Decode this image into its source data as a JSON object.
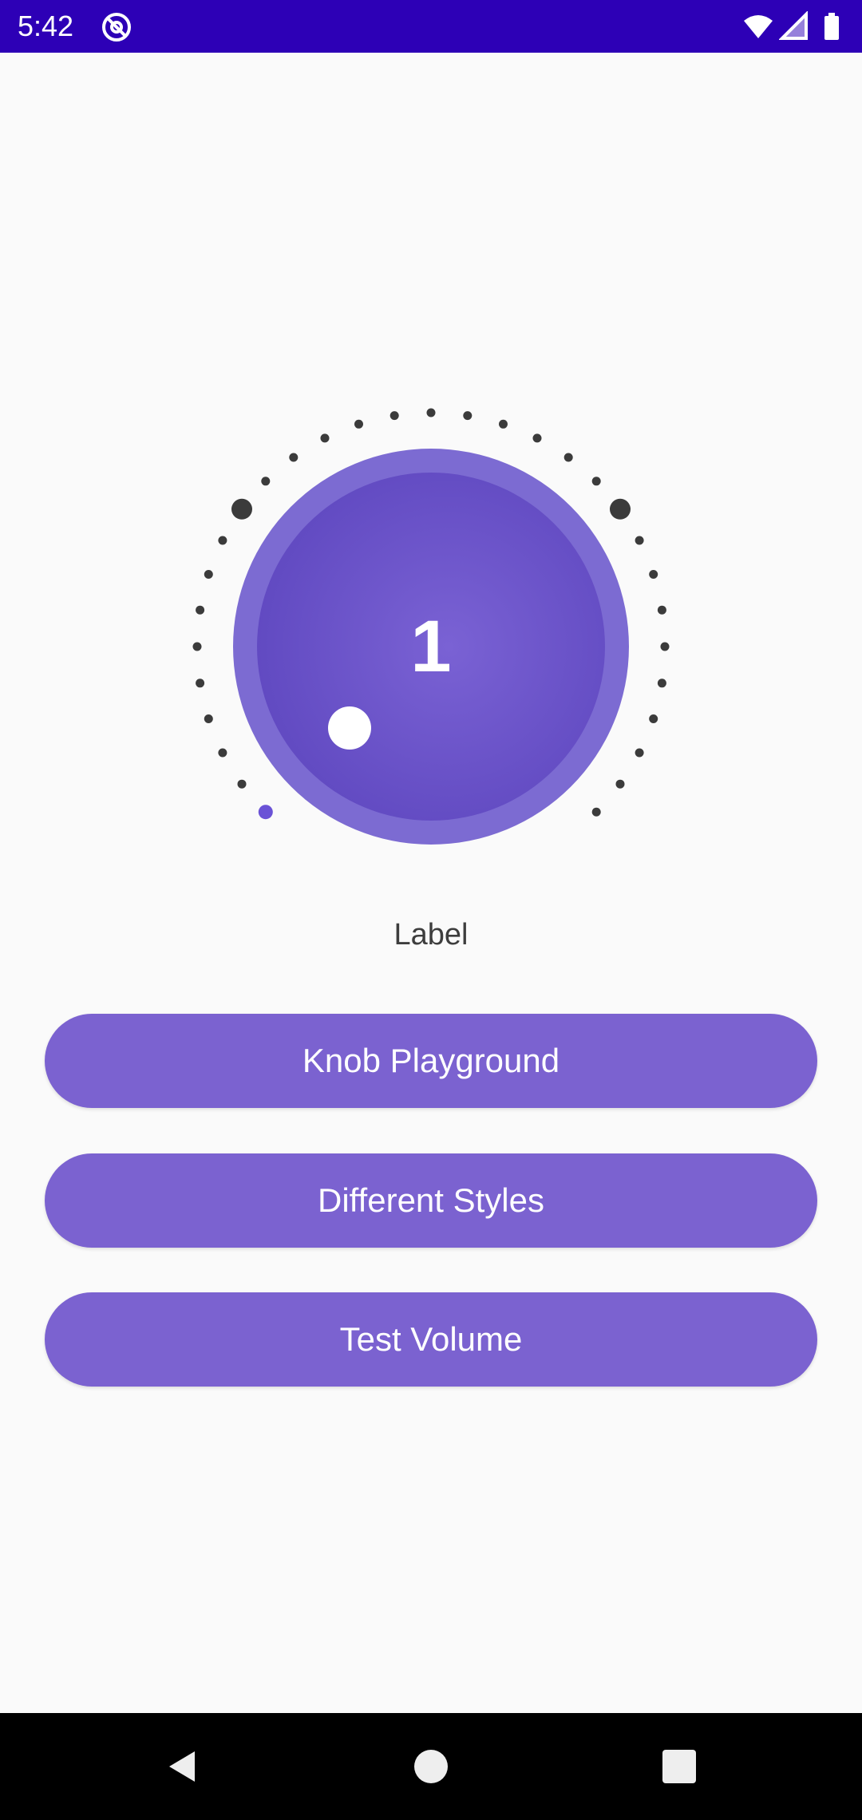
{
  "status_bar": {
    "time": "5:42",
    "app_icon": "at-sign-circle-icon",
    "wifi_icon": "wifi-icon",
    "signal_icon": "cell-signal-icon",
    "battery_icon": "battery-icon",
    "background": "#2d00b6"
  },
  "knob": {
    "value": "1",
    "label": "Label",
    "level_fraction": 0.0,
    "colors": {
      "outer_ring": "#7c6bd2",
      "inner_face": "#6a4fc9",
      "indicator": "#ffffff",
      "tick_dot": "#3b3b3b",
      "active_dot": "#6a52d6"
    }
  },
  "buttons": {
    "playground": "Knob Playground",
    "styles": "Different Styles",
    "volume": "Test Volume",
    "color": "#7b62d0"
  },
  "nav_bar": {
    "back_icon": "back-triangle-icon",
    "home_icon": "home-circle-icon",
    "recent_icon": "recents-square-icon"
  }
}
